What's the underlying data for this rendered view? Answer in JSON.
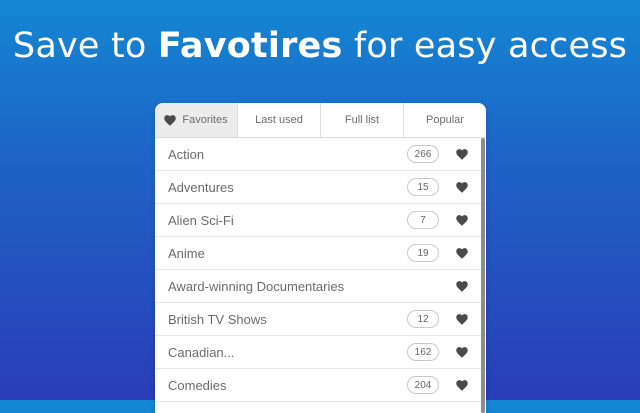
{
  "headline": {
    "prefix": "Save to ",
    "bold": "Favotires",
    "suffix": " for easy access"
  },
  "tabs": [
    {
      "label": "Favorites",
      "icon": "heart-icon",
      "active": true
    },
    {
      "label": "Last used",
      "active": false
    },
    {
      "label": "Full list",
      "active": false
    },
    {
      "label": "Popular",
      "active": false
    }
  ],
  "rows": [
    {
      "label": "Action",
      "count": "266"
    },
    {
      "label": "Adventures",
      "count": "15"
    },
    {
      "label": "Alien Sci-Fi",
      "count": "7"
    },
    {
      "label": "Anime",
      "count": "19"
    },
    {
      "label": "Award-winning Documentaries",
      "count": ""
    },
    {
      "label": "British TV Shows",
      "count": "12"
    },
    {
      "label": "Canadian...",
      "count": "162"
    },
    {
      "label": "Comedies",
      "count": "204"
    }
  ],
  "colors": {
    "gradient_top": "#1487d2",
    "gradient_bottom": "#2a3db8",
    "heart": "#4a4a4a"
  }
}
